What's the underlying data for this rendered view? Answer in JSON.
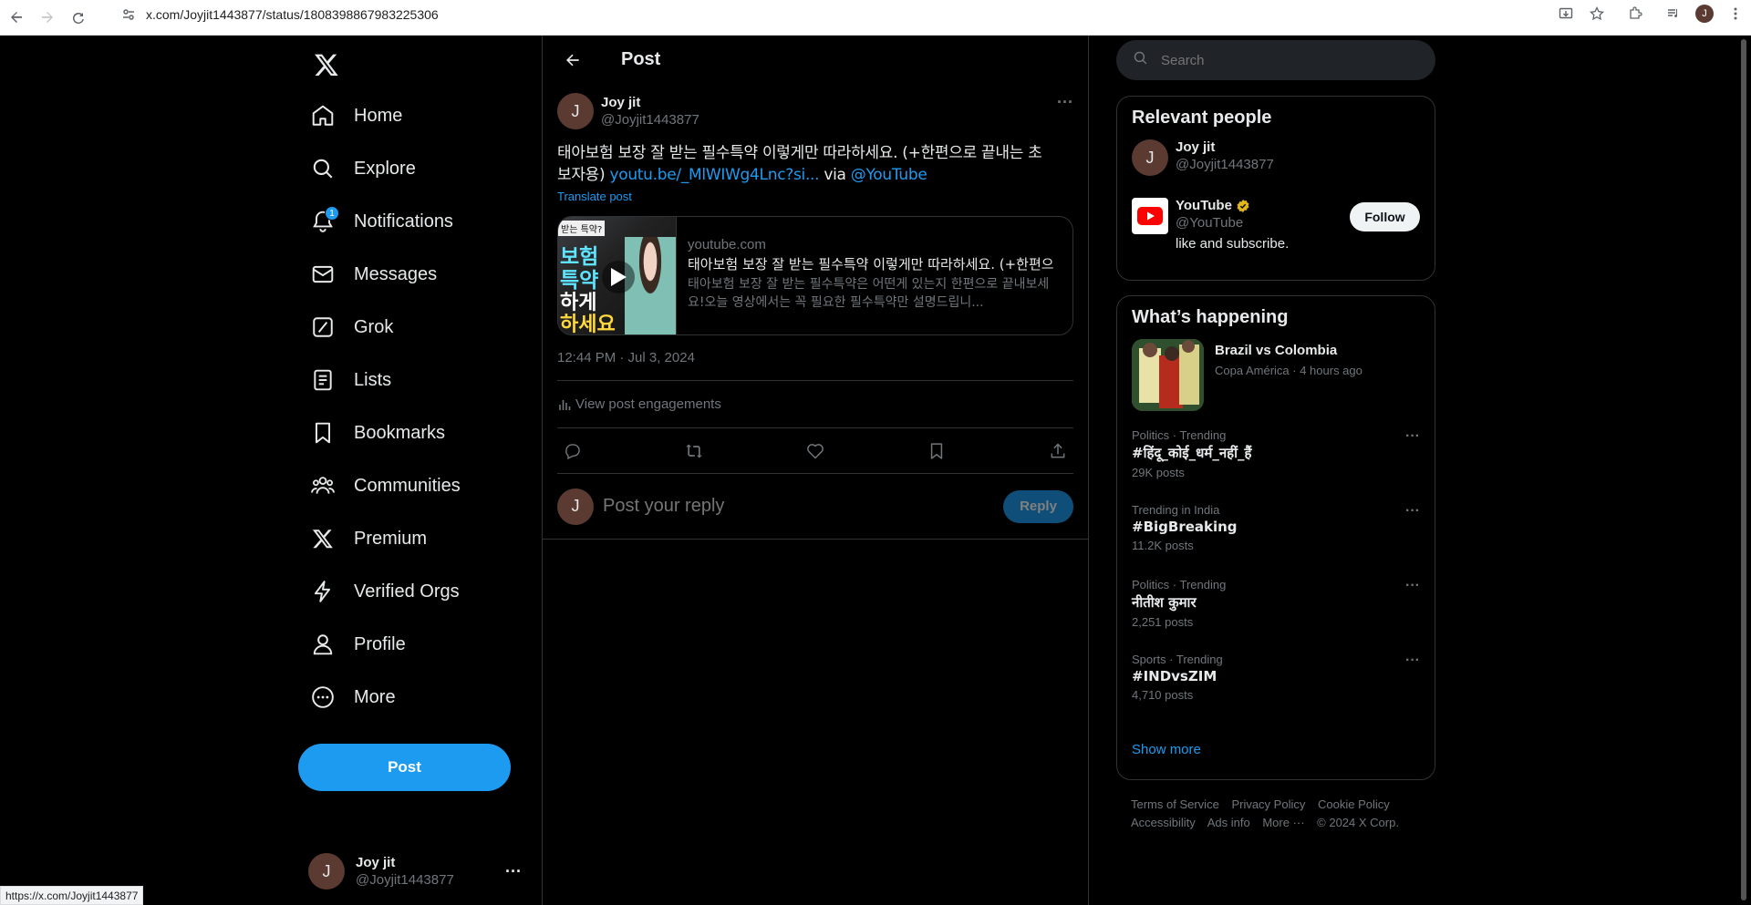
{
  "browser": {
    "url": "x.com/Joyjit1443877/status/1808398867983225306",
    "status_url": "https://x.com/Joyjit1443877",
    "profile_initial": "J"
  },
  "nav": {
    "items": [
      {
        "label": "Home",
        "icon": "home-icon"
      },
      {
        "label": "Explore",
        "icon": "search-icon"
      },
      {
        "label": "Notifications",
        "icon": "bell-icon",
        "badge": "1"
      },
      {
        "label": "Messages",
        "icon": "mail-icon"
      },
      {
        "label": "Grok",
        "icon": "grok-icon"
      },
      {
        "label": "Lists",
        "icon": "list-icon"
      },
      {
        "label": "Bookmarks",
        "icon": "bookmark-icon"
      },
      {
        "label": "Communities",
        "icon": "communities-icon"
      },
      {
        "label": "Premium",
        "icon": "x-logo-icon"
      },
      {
        "label": "Verified Orgs",
        "icon": "lightning-icon"
      },
      {
        "label": "Profile",
        "icon": "person-icon"
      },
      {
        "label": "More",
        "icon": "more-circle-icon"
      }
    ],
    "post_button": "Post",
    "account": {
      "initial": "J",
      "name": "Joy jit",
      "handle": "@Joyjit1443877"
    }
  },
  "main": {
    "header_title": "Post",
    "tweet": {
      "initial": "J",
      "author_name": "Joy jit",
      "author_handle": "@Joyjit1443877",
      "text_line1": "태아보험 보장 잘 받는 필수특약 이렇게만 따라하세요. (+한편으로 끝내는 초",
      "text_line2_prefix": "보자용) ",
      "link_text": "youtu.be/_MlWIWg4Lnc?si...",
      "via_text": " via ",
      "mention": "@YouTube",
      "translate": "Translate post",
      "card": {
        "domain": "youtube.com",
        "title": "태아보험 보장 잘 받는 필수특약 이렇게만 따라하세요. (+한편으",
        "description": "태아보험 보장 잘 받는 필수특약은 어떤게 있는지 한편으로 끝내보세요!오늘 영상에서는 꼭 필요한 필수특약만 설명드립니...",
        "thumb_text": [
          "받는 특약?",
          "보험",
          "특약",
          "하게",
          "하세요"
        ]
      },
      "timestamp": "12:44 PM · Jul 3, 2024",
      "engagements": "View post engagements"
    },
    "reply": {
      "initial": "J",
      "placeholder": "Post your reply",
      "button": "Reply"
    }
  },
  "right": {
    "search_placeholder": "Search",
    "relevant_people": {
      "title": "Relevant people",
      "people": [
        {
          "initial": "J",
          "name": "Joy jit",
          "handle": "@Joyjit1443877"
        },
        {
          "name": "YouTube",
          "handle": "@YouTube",
          "bio": "like and subscribe.",
          "follow": "Follow"
        }
      ]
    },
    "whats_happening": {
      "title": "What’s happening",
      "featured": {
        "title": "Brazil vs Colombia",
        "meta": "Copa América · 4 hours ago"
      },
      "trends": [
        {
          "category": "Politics · Trending",
          "name": "#हिंदू_कोई_धर्म_नहीं_हैं",
          "posts": "29K posts"
        },
        {
          "category": "Trending in India",
          "name": "#BigBreaking",
          "posts": "11.2K posts"
        },
        {
          "category": "Politics · Trending",
          "name": "नीतीश कुमार",
          "posts": "2,251 posts"
        },
        {
          "category": "Sports · Trending",
          "name": "#INDvsZIM",
          "posts": "4,710 posts"
        }
      ],
      "show_more": "Show more"
    },
    "footer": {
      "line1": [
        "Terms of Service",
        "Privacy Policy",
        "Cookie Policy"
      ],
      "line2": [
        "Accessibility",
        "Ads info",
        "More ···",
        "© 2024 X Corp."
      ]
    }
  },
  "colors": {
    "accent": "#1d9bf0",
    "background": "#000000",
    "border": "#2f3336",
    "muted": "#71767b"
  }
}
